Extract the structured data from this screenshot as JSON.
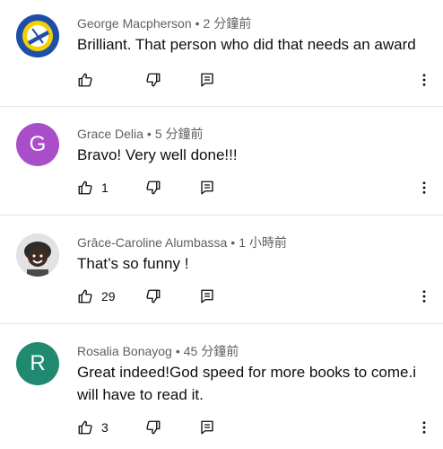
{
  "comments": [
    {
      "author": "George Macpherson",
      "time": "2 分鐘前",
      "text": "Brilliant. That person who did that needs an award",
      "likes": "",
      "avatar": {
        "type": "image",
        "name": "club-crest-avatar",
        "color": "#f5d000"
      }
    },
    {
      "author": "Grace Delia",
      "time": "5 分鐘前",
      "text": "Bravo!  Very well done!!!",
      "likes": "1",
      "avatar": {
        "type": "letter",
        "letter": "G",
        "color": "#a94dc9"
      }
    },
    {
      "author": "Grâce-Caroline Alumbassa",
      "time": "1 小時前",
      "text": "That’s so funny !",
      "likes": "29",
      "avatar": {
        "type": "image",
        "name": "photo-avatar",
        "color": "#cfcfcf"
      }
    },
    {
      "author": "Rosalia Bonayog",
      "time": "45 分鐘前",
      "text": "Great indeed!God speed for more books to come.i will have to read it.",
      "likes": "3",
      "avatar": {
        "type": "letter",
        "letter": "R",
        "color": "#1f8a70"
      }
    }
  ],
  "separator": "•",
  "icons": {
    "like": "thumb-up-icon",
    "dislike": "thumb-down-icon",
    "reply": "reply-icon",
    "more": "more-vert-icon"
  }
}
